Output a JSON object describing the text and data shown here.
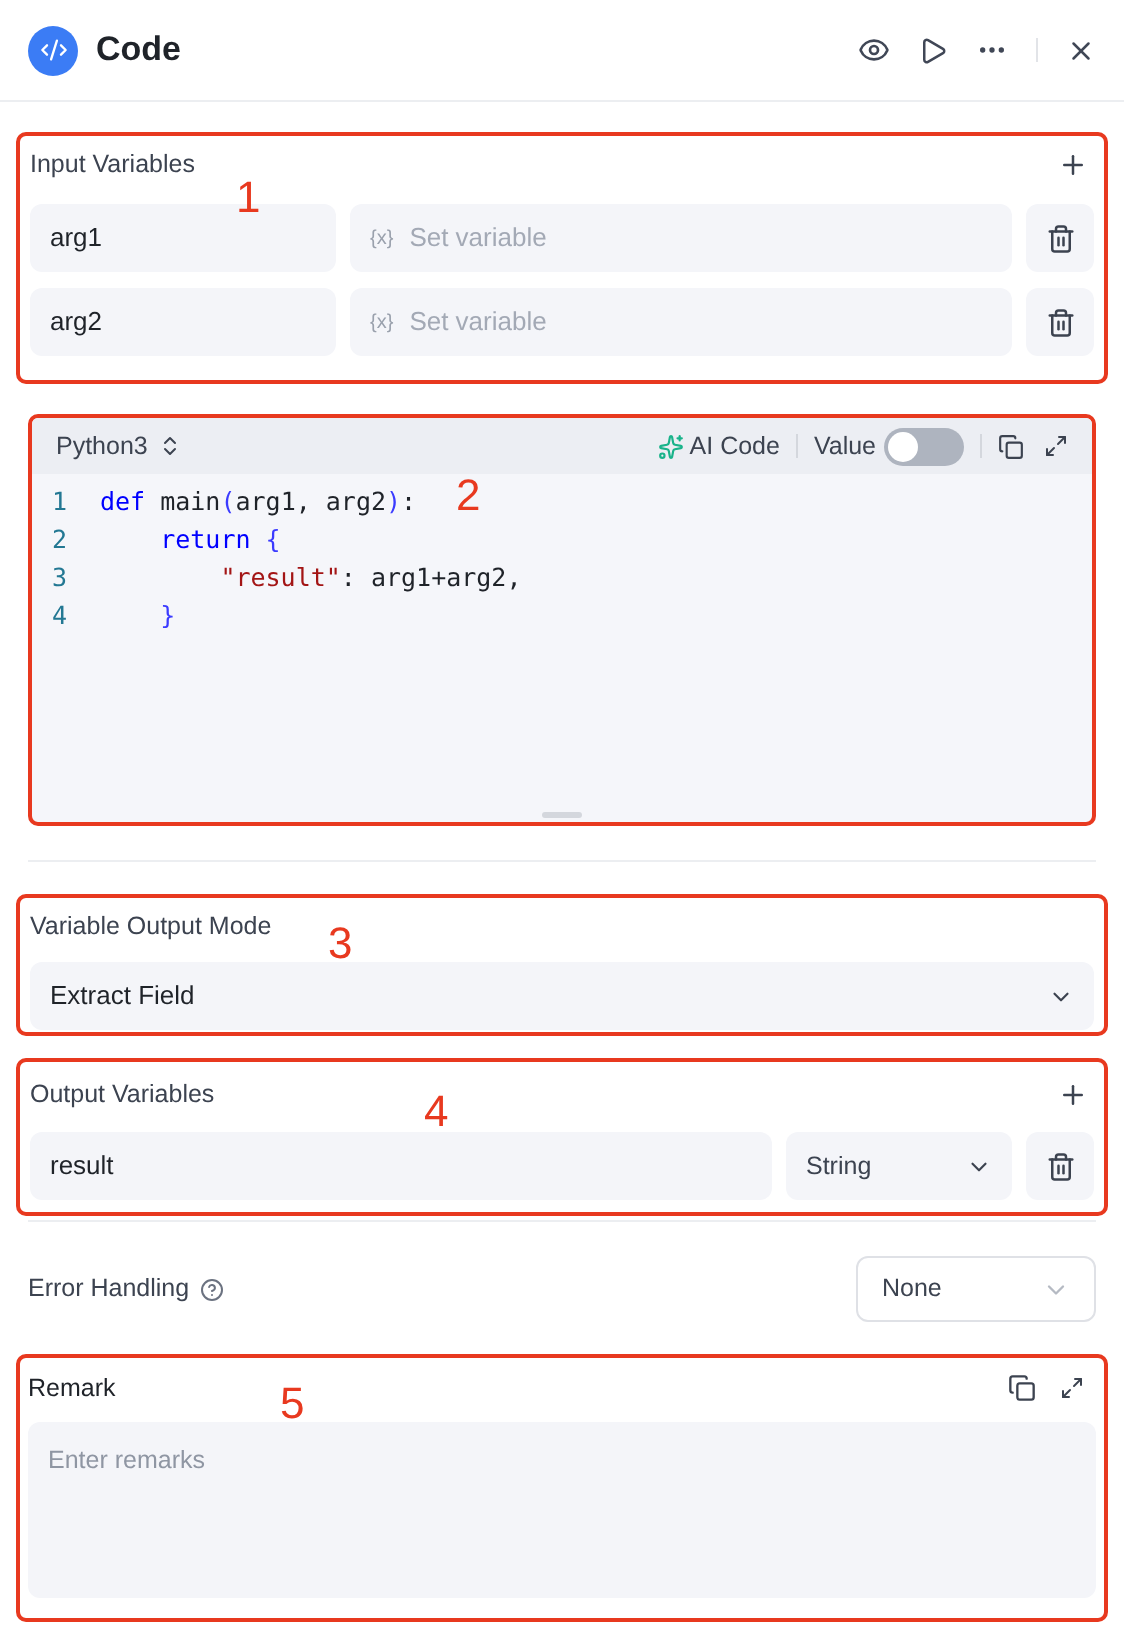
{
  "header": {
    "title": "Code"
  },
  "input_variables": {
    "annotation": "1",
    "label": "Input Variables",
    "rows": [
      {
        "name": "arg1",
        "placeholder": "Set variable",
        "prefix": "{x}"
      },
      {
        "name": "arg2",
        "placeholder": "Set variable",
        "prefix": "{x}"
      }
    ]
  },
  "code_editor": {
    "annotation": "2",
    "language": "Python3",
    "ai_button": "AI Code",
    "value_toggle": {
      "label": "Value",
      "on": false
    },
    "lines": [
      {
        "number": "1",
        "tokens": [
          {
            "text": "def",
            "kind": "keyword"
          },
          {
            "text": " main",
            "kind": "plain"
          },
          {
            "text": "(",
            "kind": "bracket"
          },
          {
            "text": "arg1, arg2",
            "kind": "plain"
          },
          {
            "text": ")",
            "kind": "bracket"
          },
          {
            "text": ":",
            "kind": "plain"
          }
        ]
      },
      {
        "number": "2",
        "tokens": [
          {
            "text": "    return",
            "kind": "keyword"
          },
          {
            "text": " {",
            "kind": "bracket"
          }
        ]
      },
      {
        "number": "3",
        "tokens": [
          {
            "text": "        \"result\"",
            "kind": "string"
          },
          {
            "text": ": arg1+arg2,",
            "kind": "plain"
          }
        ]
      },
      {
        "number": "4",
        "tokens": [
          {
            "text": "    }",
            "kind": "bracket"
          }
        ]
      }
    ]
  },
  "output_mode": {
    "annotation": "3",
    "label": "Variable Output Mode",
    "value": "Extract Field"
  },
  "output_variables": {
    "annotation": "4",
    "label": "Output Variables",
    "rows": [
      {
        "name": "result",
        "type": "String"
      }
    ]
  },
  "error_handling": {
    "label": "Error Handling",
    "value": "None"
  },
  "remark": {
    "annotation": "5",
    "label": "Remark",
    "placeholder": "Enter remarks"
  }
}
